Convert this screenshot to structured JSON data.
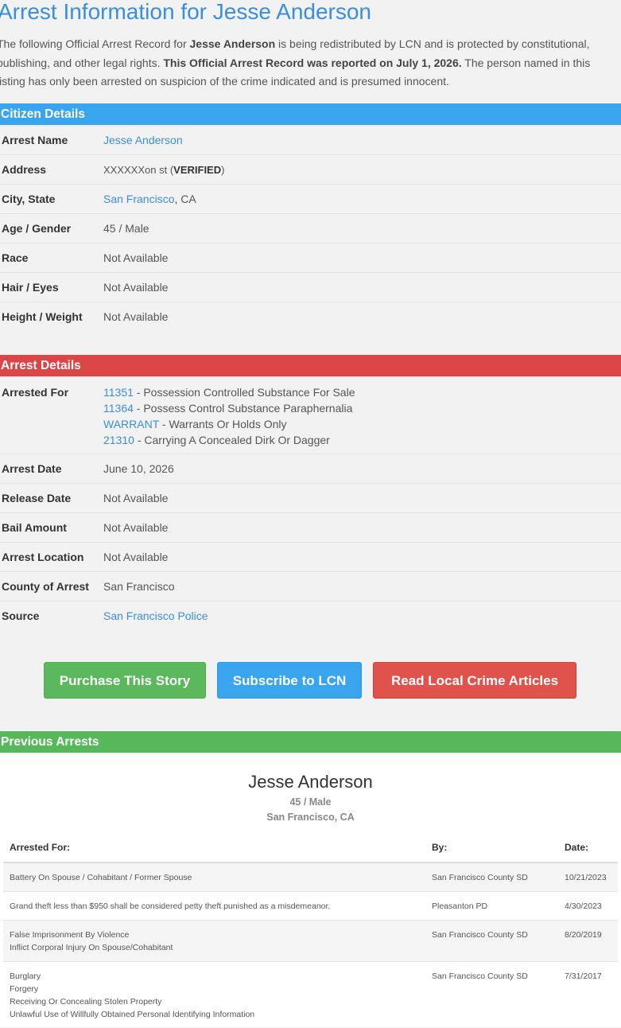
{
  "page": {
    "title": "Arrest Information for Jesse Anderson",
    "intro": {
      "part1": "The following Official Arrest Record for ",
      "name_bold": "Jesse Anderson",
      "part2": " is being redistributed by LCN and is protected by constitutional, publishing, and other legal rights. ",
      "reported_bold": "This Official Arrest Record was reported on July 1, 2026.",
      "part3": " The person named in this listing has only been arrested on suspicion of the crime indicated and is presumed innocent."
    }
  },
  "citizen": {
    "heading": "Citizen Details",
    "rows": [
      {
        "label": "Arrest Name",
        "value": "Jesse Anderson"
      },
      {
        "label": "Address",
        "value_prefix": "XXXXXXon st (",
        "value_bold": "VERIFIED",
        "value_suffix": ")"
      },
      {
        "label": "City, State",
        "city": "San Francisco",
        "state": ", CA"
      },
      {
        "label": "Age / Gender",
        "value": "45 / Male"
      },
      {
        "label": "Race",
        "value": "Not Available"
      },
      {
        "label": "Hair / Eyes",
        "value": "Not Available"
      },
      {
        "label": "Height / Weight",
        "value": "Not Available"
      }
    ]
  },
  "arrest": {
    "heading": "Arrest Details",
    "arrested_for_label": "Arrested For",
    "charges": [
      {
        "code": "11351",
        "desc": " - Possession Controlled Substance For Sale"
      },
      {
        "code": "11364",
        "desc": " - Possess Control Substance Paraphernalia"
      },
      {
        "code": "WARRANT",
        "desc": " - Warrants Or Holds Only"
      },
      {
        "code": "21310",
        "desc": " - Carrying A Concealed Dirk Or Dagger"
      }
    ],
    "rows": [
      {
        "label": "Arrest Date",
        "value": "June 10, 2026"
      },
      {
        "label": "Release Date",
        "value": "Not Available"
      },
      {
        "label": "Bail Amount",
        "value": "Not Available"
      },
      {
        "label": "Arrest Location",
        "value": "Not Available"
      },
      {
        "label": "County of Arrest",
        "value": "San Francisco"
      },
      {
        "label": "Source",
        "value": "San Francisco Police"
      }
    ]
  },
  "buttons": {
    "purchase": "Purchase This Story",
    "subscribe": "Subscribe to LCN",
    "read": "Read Local Crime Articles"
  },
  "previous": {
    "heading": "Previous Arrests",
    "name": "Jesse Anderson",
    "age_gender": "45 / Male",
    "location": "San Francisco, CA",
    "columns": {
      "arrested_for": "Arrested For:",
      "by": "By:",
      "date": "Date:"
    },
    "records": [
      {
        "charges": [
          "Battery On Spouse / Cohabitant / Former Spouse"
        ],
        "by": "San Francisco County SD",
        "date": "10/21/2023"
      },
      {
        "charges": [
          "Grand theft less than $950 shall be considered petty theft punished as a misdemeanor."
        ],
        "by": "Pleasanton PD",
        "date": "4/30/2023"
      },
      {
        "charges": [
          "False Imprisonment By Violence",
          "Inflict Corporal Injury On Spouse/Cohabitant"
        ],
        "by": "San Francisco County SD",
        "date": "8/20/2019"
      },
      {
        "charges": [
          "Burglary",
          "Forgery",
          "Receiving Or Concealing Stolen Property",
          "Unlawful Use of Willfully Obtained Personal Identifying Information"
        ],
        "by": "San Francisco County SD",
        "date": "7/31/2017"
      }
    ]
  },
  "colors": {
    "link": "#3a8ee0",
    "citizen_bar": "#3aa5ef",
    "arrest_bar": "#dc4545",
    "previous_bar": "#56b85a"
  }
}
